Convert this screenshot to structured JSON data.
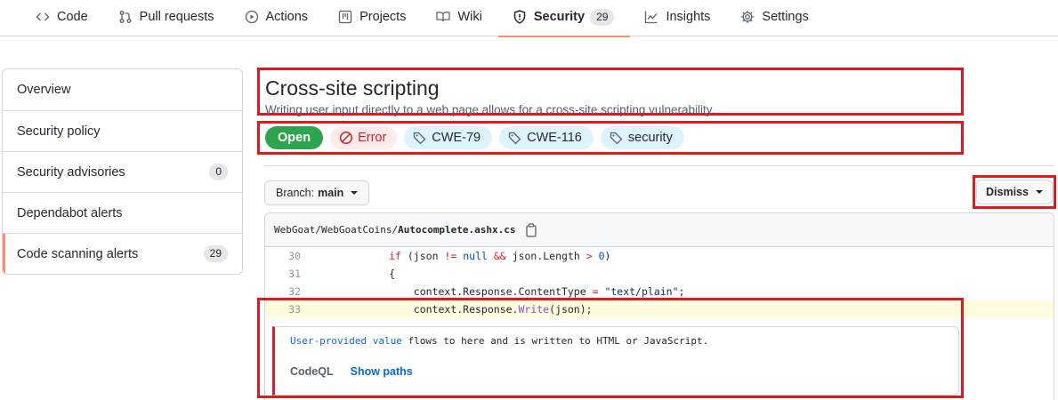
{
  "nav": {
    "tabs": [
      {
        "label": "Code",
        "icon": "code-icon"
      },
      {
        "label": "Pull requests",
        "icon": "pull-request-icon"
      },
      {
        "label": "Actions",
        "icon": "play-icon"
      },
      {
        "label": "Projects",
        "icon": "table-icon"
      },
      {
        "label": "Wiki",
        "icon": "book-icon"
      },
      {
        "label": "Security",
        "icon": "shield-icon",
        "count": "29",
        "active": true
      },
      {
        "label": "Insights",
        "icon": "graph-icon"
      },
      {
        "label": "Settings",
        "icon": "gear-icon"
      }
    ]
  },
  "sidebar": {
    "items": [
      {
        "label": "Overview"
      },
      {
        "label": "Security policy"
      },
      {
        "label": "Security advisories",
        "count": "0"
      },
      {
        "label": "Dependabot alerts"
      },
      {
        "label": "Code scanning alerts",
        "count": "29",
        "selected": true
      }
    ]
  },
  "alert": {
    "title": "Cross-site scripting",
    "description": "Writing user input directly to a web page allows for a cross-site scripting vulnerability.",
    "status": "Open",
    "severity": "Error",
    "tags": [
      "CWE-79",
      "CWE-116",
      "security"
    ]
  },
  "toolbar": {
    "branch_prefix": "Branch:",
    "branch_name": "main",
    "dismiss_label": "Dismiss"
  },
  "code": {
    "path_prefix": "WebGoat/WebGoatCoins/",
    "file_name": "Autocomplete.ashx.cs",
    "lines": [
      {
        "num": "30",
        "text": "            if (json != null && json.Length > 0)"
      },
      {
        "num": "31",
        "text": "            {"
      },
      {
        "num": "32",
        "text": "                context.Response.ContentType = \"text/plain\";"
      },
      {
        "num": "33",
        "text": "                context.Response.Write(json);"
      }
    ]
  },
  "finding": {
    "source_link": "User-provided value",
    "message_rest": " flows to here and is written to HTML or JavaScript.",
    "tool": "CodeQL",
    "show_paths": "Show paths"
  },
  "colors": {
    "accent_underline": "#fd8c73",
    "open_green": "#2da44e",
    "error_red": "#cf222e",
    "link_blue": "#0969da",
    "annotation_red": "#e0191f"
  }
}
